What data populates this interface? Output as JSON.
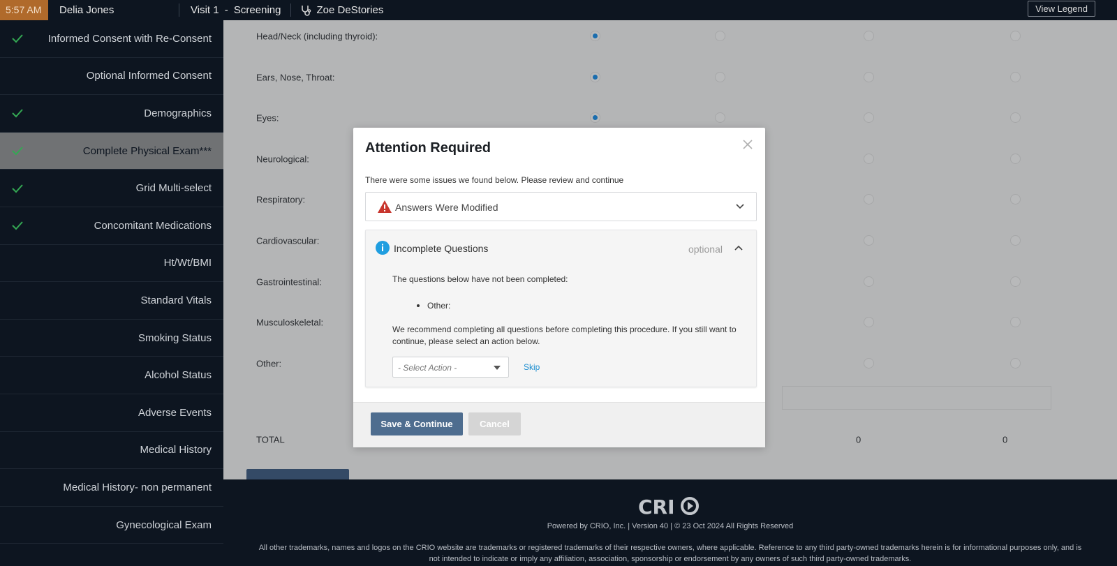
{
  "topbar": {
    "time": "5:57 AM",
    "patient": "Delia Jones",
    "visit": "Visit 1",
    "visit_type": "Screening",
    "investigator": "Zoe DeStories",
    "legend_button": "View Legend"
  },
  "sidebar": {
    "items": [
      {
        "label": "Informed Consent with Re-Consent",
        "done": true
      },
      {
        "label": "Optional Informed Consent",
        "done": false
      },
      {
        "label": "Demographics",
        "done": true
      },
      {
        "label": "Complete Physical Exam***",
        "done": true,
        "active": true
      },
      {
        "label": "Grid Multi-select",
        "done": true
      },
      {
        "label": "Concomitant Medications",
        "done": true
      },
      {
        "label": "Ht/Wt/BMI",
        "done": false
      },
      {
        "label": "Standard Vitals",
        "done": false
      },
      {
        "label": "Smoking Status",
        "done": false
      },
      {
        "label": "Alcohol Status",
        "done": false
      },
      {
        "label": "Adverse Events",
        "done": false
      },
      {
        "label": "Medical History",
        "done": false
      },
      {
        "label": "Medical History- non permanent",
        "done": false
      },
      {
        "label": "Gynecological Exam",
        "done": false
      }
    ]
  },
  "exam": {
    "rows": [
      {
        "label": "Head/Neck (including thyroid):",
        "selected_col": 0
      },
      {
        "label": "Ears, Nose, Throat:",
        "selected_col": 0
      },
      {
        "label": "Eyes:",
        "selected_col": 0
      },
      {
        "label": "Neurological:",
        "selected_col": null
      },
      {
        "label": "Respiratory:",
        "selected_col": null
      },
      {
        "label": "Cardiovascular:",
        "selected_col": null
      },
      {
        "label": "Gastrointestinal:",
        "selected_col": null
      },
      {
        "label": "Musculoskeletal:",
        "selected_col": null
      },
      {
        "label": "Other:",
        "selected_col": null
      }
    ],
    "total_label": "TOTAL",
    "total_col3": "0",
    "total_col4": "0"
  },
  "modal": {
    "title": "Attention Required",
    "intro": "There were some issues we found below. Please review and continue",
    "issue_modified": "Answers Were Modified",
    "issue_incomplete": "Incomplete Questions",
    "optional": "optional",
    "not_completed": "The questions below have not been completed:",
    "question_other": "Other:",
    "recommend": "We recommend completing all questions before completing this procedure. If you still want to continue, please select an action below.",
    "select_placeholder": "- Select Action -",
    "skip": "Skip",
    "save_button": "Save & Continue",
    "cancel_button": "Cancel"
  },
  "footer": {
    "powered": "Powered by CRIO, Inc. | Version 40 |  ©  23 Oct 2024 All Rights Reserved",
    "trademarks": "All other trademarks, names and logos on the CRIO website are trademarks or registered trademarks of their respective owners, where applicable. Reference to any third party-owned trademarks herein is for informational purposes only, and is not intended to indicate or imply any affiliation, association, sponsorship or endorsement by any owners of such third party-owned trademarks."
  },
  "colors": {
    "accent_blue": "#1f8fd0",
    "check_green": "#34a853",
    "warning_red": "#c8352d",
    "primary_button": "#4e6d8f"
  }
}
